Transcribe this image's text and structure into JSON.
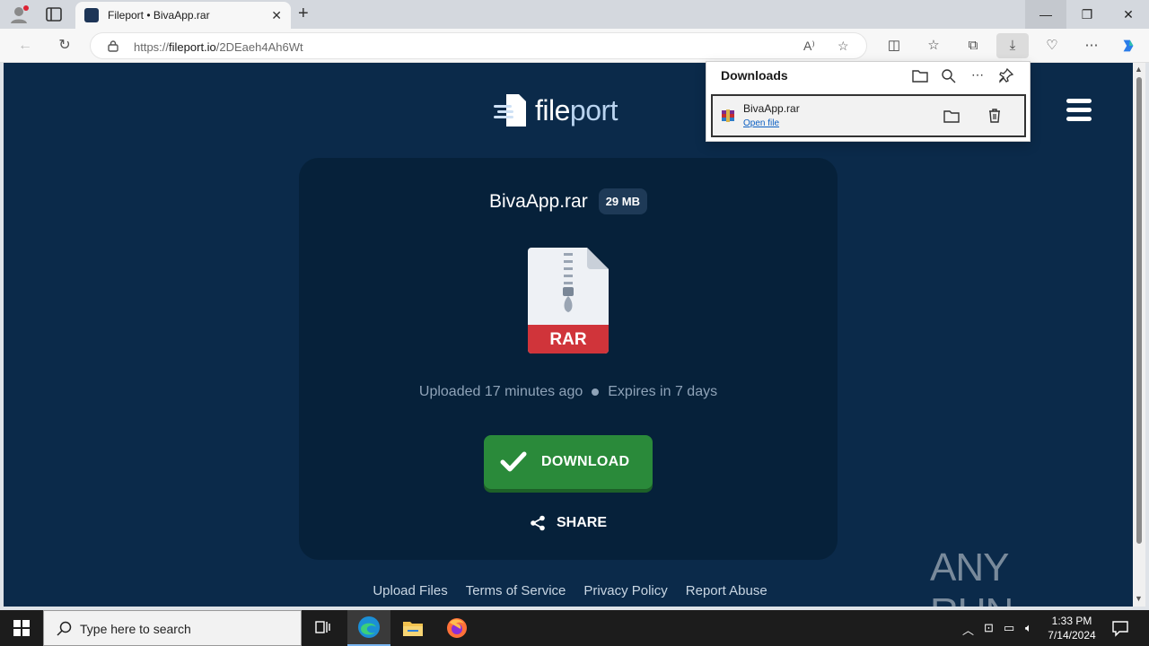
{
  "browser": {
    "tab_title": "Fileport • BivaApp.rar",
    "url_prefix": "https://",
    "url_domain": "fileport.io",
    "url_path": "/2DEaeh4Ah6Wt"
  },
  "page": {
    "logo_text_a": "file",
    "logo_text_b": "port",
    "file_name": "BivaApp.rar",
    "file_size": "29 MB",
    "file_type_label": "RAR",
    "uploaded": "Uploaded 17 minutes ago",
    "expires": "Expires in 7 days",
    "download_label": "DOWNLOAD",
    "share_label": "SHARE",
    "footer_links": [
      "Upload Files",
      "Terms of Service",
      "Privacy Policy",
      "Report Abuse"
    ],
    "watermark": "ANY RUN"
  },
  "downloads": {
    "header": "Downloads",
    "item_name": "BivaApp.rar",
    "item_action": "Open file"
  },
  "taskbar": {
    "search_placeholder": "Type here to search",
    "time": "1:33 PM",
    "date": "7/14/2024"
  },
  "colors": {
    "page_bg": "#0b2a4a",
    "card_bg": "#06213a",
    "download_green": "#2a8a3a",
    "rar_red": "#d0343a"
  }
}
